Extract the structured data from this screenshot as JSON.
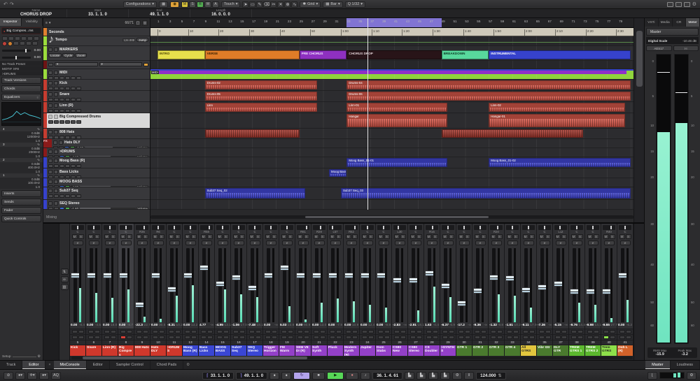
{
  "icons": {
    "undo": "↶",
    "redo": "↷",
    "camera": "◉",
    "grid": "▦",
    "dropdown": "▾",
    "snap": "✱",
    "gear": "⚙",
    "search": "◎",
    "window": "▢",
    "note": "♪",
    "folder": "▣",
    "marker": "◆",
    "menu": "≡",
    "close": "×",
    "play": "▶",
    "stop": "■",
    "cycle": "↻",
    "record": "●",
    "metronome": "‖",
    "updown": "⇅",
    "arrow": "➤"
  },
  "topbar": {
    "configurations": "Configurations",
    "touch": "Touch",
    "grid": "Grid",
    "bar": "Bar",
    "quantize": "Q 1/32",
    "auto": [
      {
        "l": "M",
        "c": "#d4bf3a"
      },
      {
        "l": "S",
        "c": ""
      },
      {
        "l": "R",
        "c": "#53ad53"
      },
      {
        "l": "W",
        "c": ""
      },
      {
        "l": "A",
        "c": ""
      }
    ],
    "tools": [
      "➤",
      "▭",
      "✎",
      "⌫",
      "✂",
      "✕",
      "⊕",
      "∿"
    ]
  },
  "infobar": {
    "columns": [
      {
        "label": "Name",
        "value": "CHORUS DROP"
      },
      {
        "label": "Start",
        "value": "33. 1. 1. 0"
      },
      {
        "label": "End",
        "value": "49. 1. 1. 0"
      },
      {
        "label": "Length",
        "value": "16. 0. 0. 0"
      }
    ]
  },
  "inspector": {
    "tabs": [
      {
        "label": "Inspector",
        "active": true
      },
      {
        "label": "Visibility",
        "active": false
      }
    ],
    "track_name": "Big Compres...ms",
    "volume": "0.00",
    "pan": "0.00",
    "preset_rows": [
      "No Track Preset",
      "MOTIF XF8",
      ">DRUMS"
    ],
    "sections_top": [
      "Track Versions",
      "Chords"
    ],
    "eq_section": "Equalizers",
    "eq_bands": [
      {
        "n": "4",
        "g": "0.0dB",
        "f": "12000Hz",
        "q": "1.0"
      },
      {
        "n": "3",
        "g": "0.0dB",
        "f": "2000Hz",
        "q": "1.0"
      },
      {
        "n": "2",
        "g": "0.0dB",
        "f": "400.0Hz",
        "q": "1.0"
      },
      {
        "n": "1",
        "g": "0.0dB",
        "f": "100.0Hz",
        "q": "1.0"
      }
    ],
    "sections_bottom": [
      "Inserts",
      "Sends",
      "Fader",
      "Quick Controls"
    ],
    "setup_label": "Setup"
  },
  "project": {
    "counter": "66/71",
    "timeline_track": "Seconds",
    "status": "Mixing",
    "ruler": {
      "bars": [
        1,
        3,
        5,
        7,
        9,
        11,
        13,
        15,
        17,
        19,
        21,
        23,
        25,
        27,
        29,
        31,
        33,
        35,
        37,
        39,
        41,
        43,
        45,
        47,
        49,
        51,
        53,
        55,
        57,
        59,
        61,
        63,
        65,
        67,
        69,
        71,
        73,
        75,
        77,
        79
      ],
      "times": [
        [
          "0",
          1
        ],
        [
          "10",
          6.2
        ],
        [
          "20",
          11.3
        ],
        [
          "30",
          16.5
        ],
        [
          "40",
          21.7
        ],
        [
          "50",
          26.8
        ],
        [
          "1:00",
          32
        ],
        [
          "1:10",
          37.2
        ],
        [
          "1:20",
          42.3
        ],
        [
          "1:30",
          47.5
        ],
        [
          "1:40",
          52.7
        ],
        [
          "1:50",
          57.8
        ],
        [
          "2:00",
          63
        ],
        [
          "2:10",
          68.2
        ],
        [
          "2:20",
          73.4
        ],
        [
          "2:30",
          78.5
        ]
      ],
      "cycle": {
        "s": 33,
        "e": 49
      },
      "playhead": 36.5
    },
    "markers": [
      {
        "label": "INTRO",
        "s": 1,
        "e": 9,
        "bg": "#e6e04c",
        "fg": "#4a4000"
      },
      {
        "label": "VERSE",
        "s": 9,
        "e": 25,
        "bg": "#e07c28",
        "fg": "#3a2000"
      },
      {
        "label": "PRE CHORUS",
        "s": 25,
        "e": 33,
        "bg": "#8e30c0",
        "fg": "#f0e0ff"
      },
      {
        "label": "CHORUS DROP",
        "s": 33,
        "e": 49,
        "bg": "#281418",
        "fg": "#e0d0d4"
      },
      {
        "label": "BREAKDOWN",
        "s": 49,
        "e": 57,
        "bg": "#58d89c",
        "fg": "#0c3a24"
      },
      {
        "label": "INSTRUMENTAL",
        "s": 57,
        "e": 81,
        "bg": "#3642cc",
        "fg": "#ffffff"
      }
    ],
    "tempo_track": {
      "name": "Tempo",
      "value": "124.000",
      "button": "Jump"
    },
    "tracks": [
      {
        "name": "Tempo",
        "type": "tempo",
        "strip": "#9bdc3c",
        "h": 14,
        "value": "124.000",
        "button": "Jump"
      },
      {
        "name": "MARKERS",
        "type": "markers",
        "strip": "#9bdc3c",
        "h": 21,
        "buttons": [
          "Locate",
          "Cycle",
          "Zoom"
        ]
      },
      {
        "name": "",
        "type": "arranger",
        "strip": "#6e1414",
        "h": 12
      },
      {
        "name": "MIDI",
        "type": "folder",
        "strip": "#9bdc3c",
        "h": 15
      },
      {
        "name": "Kick",
        "type": "audio",
        "strip": "#c63c30",
        "h": 16,
        "clips": [
          {
            "s": 9,
            "e": 28,
            "l": "Drums-02"
          },
          {
            "s": 33,
            "e": 81,
            "l": "Drums-04"
          }
        ]
      },
      {
        "name": "Snare",
        "type": "audio",
        "strip": "#c63c30",
        "h": 16,
        "clips": [
          {
            "s": 9,
            "e": 28,
            "l": "Drums-05"
          },
          {
            "s": 33,
            "e": 81,
            "l": "Drums-06"
          }
        ]
      },
      {
        "name": "Linn (R)",
        "type": "audio",
        "strip": "#c63c30",
        "h": 16,
        "clips": [
          {
            "s": 9,
            "e": 28,
            "l": "Linn"
          },
          {
            "s": 33,
            "e": 50,
            "l": "Linn-01"
          },
          {
            "s": 57,
            "e": 80,
            "l": "Linn-02"
          }
        ]
      },
      {
        "name": "Big Compressed Drums",
        "type": "audio",
        "strip": "#c63c30",
        "h": 22,
        "selected": true,
        "clips": [
          {
            "s": 33,
            "e": 50,
            "l": "Hangar"
          },
          {
            "s": 57,
            "e": 80,
            "l": "Hangar-01"
          }
        ]
      },
      {
        "name": "808 Hats",
        "type": "audio",
        "strip": "#c63c30",
        "h": 15,
        "clip_color": "#a83a30",
        "clips": [
          {
            "s": 9,
            "e": 25,
            "l": ""
          },
          {
            "s": 49,
            "e": 73,
            "l": ""
          }
        ]
      },
      {
        "name": "Hats DLY",
        "type": "fx",
        "strip": "#8a1a1a",
        "h": 13,
        "badge": "FX",
        "vol": "-5.00",
        "vol_label": "Volume"
      },
      {
        "name": ">DRUMS",
        "type": "group",
        "strip": "#8a1a1a",
        "h": 13,
        "vol": "-4.10",
        "vol_label": "Volume"
      },
      {
        "name": "Moog Bass (R)",
        "type": "audio",
        "strip": "#3642cc",
        "h": 16,
        "clip_color": "#4348d8",
        "clips": [
          {
            "s": 33,
            "e": 50,
            "l": "Moog Bass_01-01"
          },
          {
            "s": 57,
            "e": 81,
            "l": "Moog Bass_01-02"
          }
        ]
      },
      {
        "name": "Bass Licks",
        "type": "audio",
        "strip": "#3642cc",
        "h": 14,
        "clip_color": "#4348d8",
        "clips": [
          {
            "s": 30,
            "e": 33,
            "l": "Moog Bass_0"
          }
        ]
      },
      {
        "name": "MOOG BASS",
        "type": "inst",
        "strip": "#3642cc",
        "h": 13,
        "vol": "-4.80",
        "vol_label": "Volume"
      },
      {
        "name": "Sub37 Seq",
        "type": "audio",
        "strip": "#3642cc",
        "h": 18,
        "clip_color": "#4348d8",
        "clips": [
          {
            "s": 9,
            "e": 26,
            "l": "Sub37 Seq_02"
          },
          {
            "s": 32,
            "e": 81,
            "l": "Sub37 Seq_03"
          }
        ]
      },
      {
        "name": "SEQ Stereo",
        "type": "inst",
        "strip": "#3642cc",
        "h": 14,
        "vol": "-1.60",
        "vol_label": "Volume"
      }
    ]
  },
  "mixer": {
    "tabs": [
      {
        "label": "MixConsole",
        "active": true
      },
      {
        "label": "Editor"
      },
      {
        "label": "Sampler Control"
      },
      {
        "label": "Chord Pads"
      }
    ],
    "palette": {
      "red": "#d0382c",
      "blue": "#3a46d4",
      "purple": "#9340c8",
      "yellow": "#e2c63e",
      "dkgreen": "#4a7a2e",
      "green": "#5cb82e",
      "ltgreen": "#8ee04a",
      "orange": "#d2622a"
    },
    "channels": [
      {
        "num": "5",
        "name": "Kick",
        "color": "red",
        "pan": "C",
        "vol": "0.00",
        "peak": "-8.4",
        "meter": 46
      },
      {
        "num": "6",
        "name": "Snare",
        "color": "red",
        "pan": "C",
        "vol": "0.00",
        "peak": "-4.5",
        "meter": 40
      },
      {
        "num": "7",
        "name": "Linn (R)",
        "color": "red",
        "pan": "C",
        "vol": "0.00",
        "peak": "-18.0",
        "meter": 33
      },
      {
        "num": "8",
        "name": "Big Compres",
        "color": "red",
        "pan": "C",
        "vol": "0.00",
        "peak": "-8.7",
        "meter": 44,
        "rec": true,
        "selected": true
      },
      {
        "num": "9",
        "name": "808 Hats",
        "color": "red",
        "pan": "R36",
        "vol": "-22.3",
        "peak": "-22.7",
        "meter": 8
      },
      {
        "num": "10",
        "name": "Hats DLY",
        "color": "red",
        "pan": "R6",
        "vol": "0.00",
        "peak": "-30.5",
        "meter": 5
      },
      {
        "num": "11",
        "name": ">DRUMS",
        "color": "red",
        "pan": "C",
        "vol": "-8.31",
        "peak": "-10.2",
        "meter": 36
      },
      {
        "num": "13",
        "name": "Moog Bass (R)",
        "color": "blue",
        "pan": "C",
        "vol": "0.00",
        "peak": "-13.2",
        "meter": 50
      },
      {
        "num": "14",
        "name": "Bass Licks",
        "color": "blue",
        "pan": "R58",
        "vol": "4.77",
        "peak": "-∞",
        "meter": 0
      },
      {
        "num": "15",
        "name": "MOOG BASS",
        "color": "blue",
        "pan": "C",
        "vol": "-4.95",
        "peak": "-13.1",
        "meter": 44
      },
      {
        "num": "16",
        "name": "Sub37 Seq",
        "color": "blue",
        "pan": "C",
        "vol": "-1.06",
        "peak": "-17.0",
        "meter": 38
      },
      {
        "num": "17",
        "name": "SEQ Stereo",
        "color": "blue",
        "pan": "C",
        "vol": "-7.48",
        "peak": "-18.1",
        "meter": 34
      },
      {
        "num": "18",
        "name": "Trigger Horizon",
        "color": "purple",
        "pan": "C",
        "vol": "0.00",
        "peak": "-∞",
        "meter": 0
      },
      {
        "num": "19",
        "name": "FM Warm",
        "color": "purple",
        "pan": "C",
        "vol": "5.03",
        "peak": "-23.8",
        "meter": 22
      },
      {
        "num": "20",
        "name": "SEM V8 DI (R)",
        "color": "purple",
        "pan": "R61",
        "vol": "0.00",
        "peak": "-80.9",
        "meter": 4
      },
      {
        "num": "21",
        "name": "Soft Synth",
        "color": "purple",
        "pan": "R29",
        "vol": "0.00",
        "peak": "-13.0",
        "meter": 26
      },
      {
        "num": "22",
        "name": "Pluck",
        "color": "purple",
        "pan": "L57",
        "vol": "0.00",
        "peak": "-7.9",
        "meter": 32
      },
      {
        "num": "23",
        "name": "Modern Synth (R)",
        "color": "purple",
        "pan": "R62",
        "vol": "0.00",
        "peak": "-10.9",
        "meter": 28
      },
      {
        "num": "24",
        "name": "Jupiter",
        "color": "purple",
        "pan": "C",
        "vol": "0.00",
        "peak": "-12.4",
        "meter": 24
      },
      {
        "num": "25",
        "name": "Dom Stabs",
        "color": "purple",
        "pan": "C",
        "vol": "0.00",
        "peak": "-9.9",
        "meter": 20
      },
      {
        "num": "26",
        "name": "CS80 New",
        "color": "purple",
        "pan": "L30",
        "vol": "-2.83",
        "peak": "-∞",
        "meter": 0
      },
      {
        "num": "27",
        "name": "CS80 Stereo",
        "color": "purple",
        "pan": "C",
        "vol": "-2.91",
        "peak": "-18.1",
        "meter": 16
      },
      {
        "num": "28",
        "name": "CS Doubler",
        "color": "purple",
        "pan": "R15",
        "vol": "1.63",
        "peak": "-0.4",
        "meter": 48
      },
      {
        "num": "29",
        "name": ">SYNTHS",
        "color": "purple",
        "pan": "C",
        "vol": "-6.37",
        "peak": "-6.9",
        "meter": 34
      },
      {
        "num": "30",
        "name": "GTR 1",
        "color": "dkgreen",
        "pan": "C",
        "vol": "-17.2",
        "peak": "-∞",
        "meter": 0
      },
      {
        "num": "31",
        "name": "GTR 2",
        "color": "dkgreen",
        "pan": "C",
        "vol": "-9.36",
        "peak": "-∞",
        "meter": 0
      },
      {
        "num": "32",
        "name": "GTR 3",
        "color": "dkgreen",
        "pan": "R20",
        "vol": "-1.32",
        "peak": "-9.8",
        "meter": 38
      },
      {
        "num": "33",
        "name": "GTR 4",
        "color": "dkgreen",
        "pan": "C",
        "vol": "-1.61",
        "peak": "-10.2",
        "meter": 36
      },
      {
        "num": "34",
        "name": "All GTRS",
        "color": "yellow",
        "pan": "C",
        "vol": "-9.11",
        "peak": "-17.9",
        "meter": 20
      },
      {
        "num": "35",
        "name": "Vibr Gtr",
        "color": "dkgreen",
        "pan": "C",
        "vol": "-7.36",
        "peak": "-∞",
        "meter": 0
      },
      {
        "num": "37",
        "name": "DLY GTR",
        "color": "dkgreen",
        "pan": "L12",
        "vol": "-5.15",
        "peak": "-∞",
        "meter": 0
      },
      {
        "num": "38",
        "name": "TREM GTRS 1",
        "color": "green",
        "pan": "C",
        "vol": "-9.76",
        "peak": "-14.4",
        "meter": 26
      },
      {
        "num": "39",
        "name": "TREM GTRS 2",
        "color": "green",
        "pan": "C",
        "vol": "-9.98",
        "peak": "-14.1",
        "meter": 24
      },
      {
        "num": "40",
        "name": "Trem GTRS",
        "color": "ltgreen",
        "pan": "R40",
        "vol": "-9.65",
        "peak": "-27.7",
        "meter": 6,
        "grn": true
      },
      {
        "num": "41",
        "name": "Ooh L (R)",
        "color": "orange",
        "pan": "C",
        "vol": "0.00",
        "peak": "-6.2",
        "meter": 30
      }
    ]
  },
  "right_panel": {
    "tabs": [
      {
        "label": "VSTi"
      },
      {
        "label": "Media"
      },
      {
        "label": "CR"
      },
      {
        "label": "Meter",
        "active": true
      }
    ],
    "master_label": "Master",
    "digital_scale_label": "Digital Scale",
    "digital_scale_value": "-10.46 dB",
    "buttons": [
      "AES17",
      "I∙I"
    ],
    "scale_ticks": [
      {
        "v": "0",
        "p": 2
      },
      {
        "v": "5",
        "p": 14
      },
      {
        "v": "10",
        "p": 24
      },
      {
        "v": "15",
        "p": 33
      },
      {
        "v": "20",
        "p": 42
      },
      {
        "v": "30",
        "p": 58
      },
      {
        "v": "40",
        "p": 72
      },
      {
        "v": "50",
        "p": 85
      },
      {
        "v": "60",
        "p": 93
      }
    ],
    "meters": [
      {
        "fill": 73,
        "peak": 6
      },
      {
        "fill": 76,
        "peak": 13
      }
    ],
    "rms_max_label": "RMS Max",
    "rms_max": "-15.9",
    "peak_max_label": "Peak Max",
    "peak_max": "-3.2",
    "bottom_tabs": [
      {
        "label": "Master",
        "active": true
      },
      {
        "label": "Loudness"
      }
    ]
  },
  "window_tabs_left": [
    {
      "label": "Track"
    },
    {
      "label": "Editor",
      "active": true
    }
  ],
  "transport": {
    "aq": "AQ",
    "left_locator": "33. 1. 1. 0",
    "right_locator": "49. 1. 1. 0",
    "position": "36. 1. 4. 61",
    "tempo": "124.000"
  }
}
